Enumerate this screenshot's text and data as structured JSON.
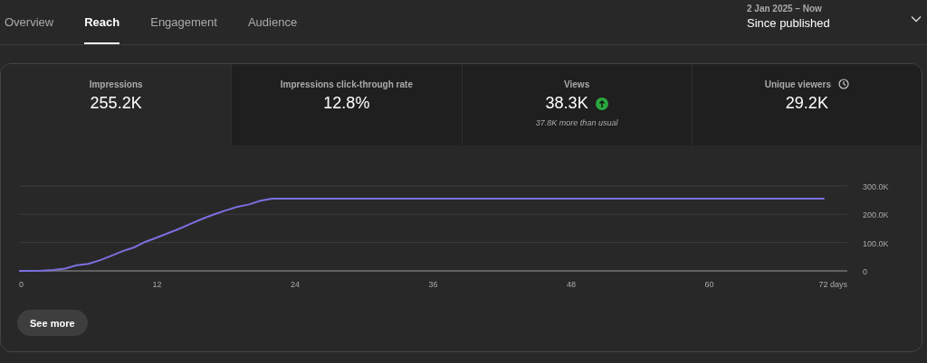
{
  "tabs": [
    {
      "label": "Overview",
      "selected": false
    },
    {
      "label": "Reach",
      "selected": true
    },
    {
      "label": "Engagement",
      "selected": false
    },
    {
      "label": "Audience",
      "selected": false
    }
  ],
  "date_range": {
    "range": "2 Jan 2025 – Now",
    "label": "Since published"
  },
  "metrics": [
    {
      "label": "Impressions",
      "value": "255.2K",
      "selected": true
    },
    {
      "label": "Impressions click-through rate",
      "value": "12.8%",
      "selected": false
    },
    {
      "label": "Views",
      "value": "38.3K",
      "selected": false,
      "trending_up": true,
      "note": "37.8K more than usual"
    },
    {
      "label": "Unique viewers",
      "value": "29.2K",
      "selected": false,
      "info": true
    }
  ],
  "chart_data": {
    "type": "line",
    "x": [
      0,
      1,
      2,
      3,
      4,
      5,
      6,
      7,
      8,
      9,
      10,
      11,
      12,
      13,
      14,
      15,
      16,
      17,
      18,
      19,
      20,
      21,
      22,
      70
    ],
    "series": [
      {
        "color": "#7b6fe0",
        "values": [
          0,
          0,
          1,
          3,
          8,
          20,
          25,
          37,
          53,
          70,
          83,
          103,
          118,
          134,
          150,
          168,
          185,
          200,
          214,
          227,
          235,
          248,
          255,
          255
        ]
      }
    ],
    "xlim": [
      0,
      72
    ],
    "ylim": [
      0,
      300
    ],
    "xticks": [
      0,
      12,
      24,
      36,
      48,
      60,
      {
        "value": 72,
        "label": "72 days"
      }
    ],
    "yticks": [
      {
        "value": 0,
        "label": "0"
      },
      {
        "value": 100,
        "label": "100.0K"
      },
      {
        "value": 200,
        "label": "200.0K"
      },
      {
        "value": 300,
        "label": "300.0K"
      }
    ]
  },
  "see_more": "See more"
}
